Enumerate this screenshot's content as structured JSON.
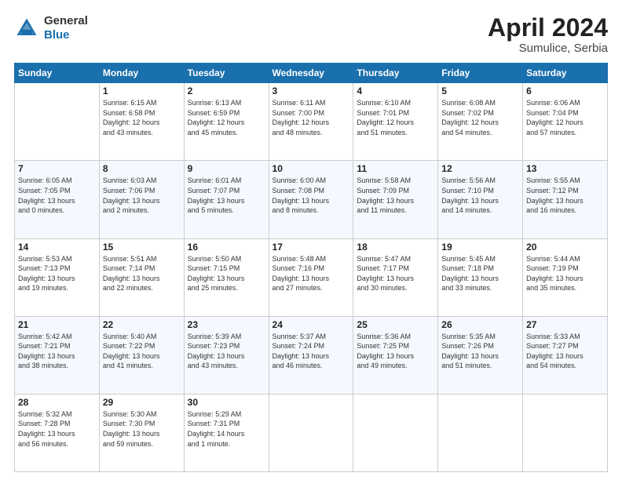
{
  "header": {
    "logo_general": "General",
    "logo_blue": "Blue",
    "title": "April 2024",
    "location": "Sumulice, Serbia"
  },
  "columns": [
    "Sunday",
    "Monday",
    "Tuesday",
    "Wednesday",
    "Thursday",
    "Friday",
    "Saturday"
  ],
  "weeks": [
    [
      {
        "day": "",
        "info": ""
      },
      {
        "day": "1",
        "info": "Sunrise: 6:15 AM\nSunset: 6:58 PM\nDaylight: 12 hours\nand 43 minutes."
      },
      {
        "day": "2",
        "info": "Sunrise: 6:13 AM\nSunset: 6:59 PM\nDaylight: 12 hours\nand 45 minutes."
      },
      {
        "day": "3",
        "info": "Sunrise: 6:11 AM\nSunset: 7:00 PM\nDaylight: 12 hours\nand 48 minutes."
      },
      {
        "day": "4",
        "info": "Sunrise: 6:10 AM\nSunset: 7:01 PM\nDaylight: 12 hours\nand 51 minutes."
      },
      {
        "day": "5",
        "info": "Sunrise: 6:08 AM\nSunset: 7:02 PM\nDaylight: 12 hours\nand 54 minutes."
      },
      {
        "day": "6",
        "info": "Sunrise: 6:06 AM\nSunset: 7:04 PM\nDaylight: 12 hours\nand 57 minutes."
      }
    ],
    [
      {
        "day": "7",
        "info": "Sunrise: 6:05 AM\nSunset: 7:05 PM\nDaylight: 13 hours\nand 0 minutes."
      },
      {
        "day": "8",
        "info": "Sunrise: 6:03 AM\nSunset: 7:06 PM\nDaylight: 13 hours\nand 2 minutes."
      },
      {
        "day": "9",
        "info": "Sunrise: 6:01 AM\nSunset: 7:07 PM\nDaylight: 13 hours\nand 5 minutes."
      },
      {
        "day": "10",
        "info": "Sunrise: 6:00 AM\nSunset: 7:08 PM\nDaylight: 13 hours\nand 8 minutes."
      },
      {
        "day": "11",
        "info": "Sunrise: 5:58 AM\nSunset: 7:09 PM\nDaylight: 13 hours\nand 11 minutes."
      },
      {
        "day": "12",
        "info": "Sunrise: 5:56 AM\nSunset: 7:10 PM\nDaylight: 13 hours\nand 14 minutes."
      },
      {
        "day": "13",
        "info": "Sunrise: 5:55 AM\nSunset: 7:12 PM\nDaylight: 13 hours\nand 16 minutes."
      }
    ],
    [
      {
        "day": "14",
        "info": "Sunrise: 5:53 AM\nSunset: 7:13 PM\nDaylight: 13 hours\nand 19 minutes."
      },
      {
        "day": "15",
        "info": "Sunrise: 5:51 AM\nSunset: 7:14 PM\nDaylight: 13 hours\nand 22 minutes."
      },
      {
        "day": "16",
        "info": "Sunrise: 5:50 AM\nSunset: 7:15 PM\nDaylight: 13 hours\nand 25 minutes."
      },
      {
        "day": "17",
        "info": "Sunrise: 5:48 AM\nSunset: 7:16 PM\nDaylight: 13 hours\nand 27 minutes."
      },
      {
        "day": "18",
        "info": "Sunrise: 5:47 AM\nSunset: 7:17 PM\nDaylight: 13 hours\nand 30 minutes."
      },
      {
        "day": "19",
        "info": "Sunrise: 5:45 AM\nSunset: 7:18 PM\nDaylight: 13 hours\nand 33 minutes."
      },
      {
        "day": "20",
        "info": "Sunrise: 5:44 AM\nSunset: 7:19 PM\nDaylight: 13 hours\nand 35 minutes."
      }
    ],
    [
      {
        "day": "21",
        "info": "Sunrise: 5:42 AM\nSunset: 7:21 PM\nDaylight: 13 hours\nand 38 minutes."
      },
      {
        "day": "22",
        "info": "Sunrise: 5:40 AM\nSunset: 7:22 PM\nDaylight: 13 hours\nand 41 minutes."
      },
      {
        "day": "23",
        "info": "Sunrise: 5:39 AM\nSunset: 7:23 PM\nDaylight: 13 hours\nand 43 minutes."
      },
      {
        "day": "24",
        "info": "Sunrise: 5:37 AM\nSunset: 7:24 PM\nDaylight: 13 hours\nand 46 minutes."
      },
      {
        "day": "25",
        "info": "Sunrise: 5:36 AM\nSunset: 7:25 PM\nDaylight: 13 hours\nand 49 minutes."
      },
      {
        "day": "26",
        "info": "Sunrise: 5:35 AM\nSunset: 7:26 PM\nDaylight: 13 hours\nand 51 minutes."
      },
      {
        "day": "27",
        "info": "Sunrise: 5:33 AM\nSunset: 7:27 PM\nDaylight: 13 hours\nand 54 minutes."
      }
    ],
    [
      {
        "day": "28",
        "info": "Sunrise: 5:32 AM\nSunset: 7:28 PM\nDaylight: 13 hours\nand 56 minutes."
      },
      {
        "day": "29",
        "info": "Sunrise: 5:30 AM\nSunset: 7:30 PM\nDaylight: 13 hours\nand 59 minutes."
      },
      {
        "day": "30",
        "info": "Sunrise: 5:29 AM\nSunset: 7:31 PM\nDaylight: 14 hours\nand 1 minute."
      },
      {
        "day": "",
        "info": ""
      },
      {
        "day": "",
        "info": ""
      },
      {
        "day": "",
        "info": ""
      },
      {
        "day": "",
        "info": ""
      }
    ]
  ]
}
